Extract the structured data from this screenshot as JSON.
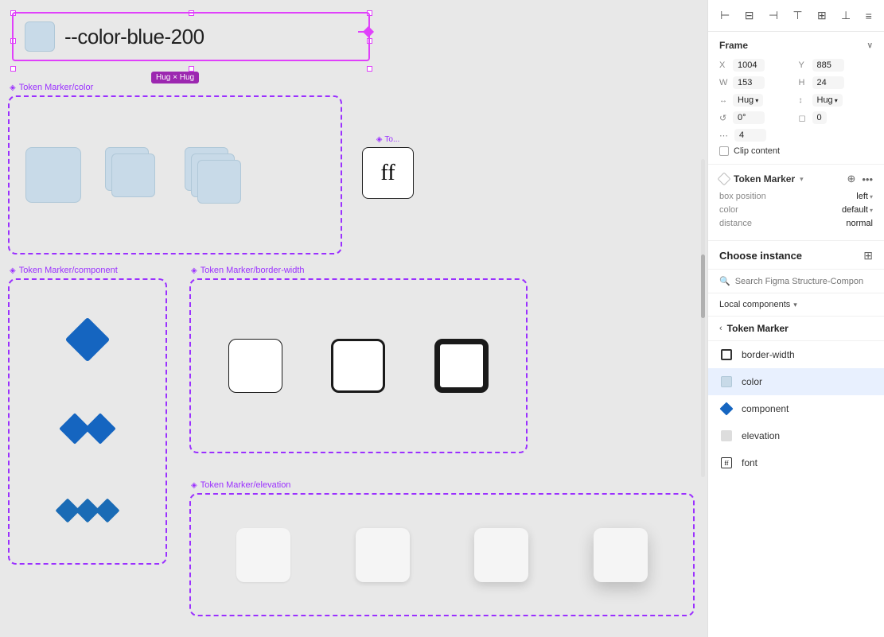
{
  "canvas": {
    "frame": {
      "label": "--color-blue-200",
      "hug_label": "Hug × Hug"
    },
    "sections": [
      {
        "id": "color",
        "label": "Token Marker/color",
        "items": [
          "single-square",
          "double-stack",
          "triple-stack"
        ]
      },
      {
        "id": "font",
        "label": "To...",
        "content": "ff"
      },
      {
        "id": "component",
        "label": "Token Marker/component"
      },
      {
        "id": "border-width",
        "label": "Token Marker/border-width"
      },
      {
        "id": "elevation",
        "label": "Token Marker/elevation"
      }
    ]
  },
  "right_panel": {
    "toolbar": {
      "icons": [
        "align-left",
        "align-center-h",
        "align-right",
        "align-top",
        "align-center-v",
        "align-bottom",
        "distribute",
        "more"
      ]
    },
    "frame_section": {
      "title": "Frame",
      "fields": {
        "x_label": "X",
        "x_value": "1004",
        "y_label": "Y",
        "y_value": "885",
        "w_label": "W",
        "w_value": "153",
        "h_label": "H",
        "h_value": "24",
        "hug_x": "Hug",
        "hug_y": "Hug",
        "rotation_label": "↺",
        "rotation_value": "0°",
        "corner_label": "◻",
        "corner_value": "0",
        "dot_value": "4",
        "clip_label": "Clip content"
      }
    },
    "plugin_section": {
      "name": "Token Marker",
      "box_position_label": "box position",
      "box_position_value": "left",
      "color_label": "color",
      "color_value": "default",
      "distance_label": "distance",
      "distance_value": "normal"
    },
    "choose_instance": {
      "title": "Choose instance",
      "search_placeholder": "Search Figma Structure-Compon",
      "local_components": "Local components",
      "back_section": "Token Marker",
      "items": [
        {
          "id": "border-width",
          "label": "border-width",
          "icon": "border"
        },
        {
          "id": "color",
          "label": "color",
          "icon": "color",
          "selected": true
        },
        {
          "id": "component",
          "label": "component",
          "icon": "diamond"
        },
        {
          "id": "elevation",
          "label": "elevation",
          "icon": "elevation"
        },
        {
          "id": "font",
          "label": "font",
          "icon": "font"
        }
      ]
    }
  }
}
